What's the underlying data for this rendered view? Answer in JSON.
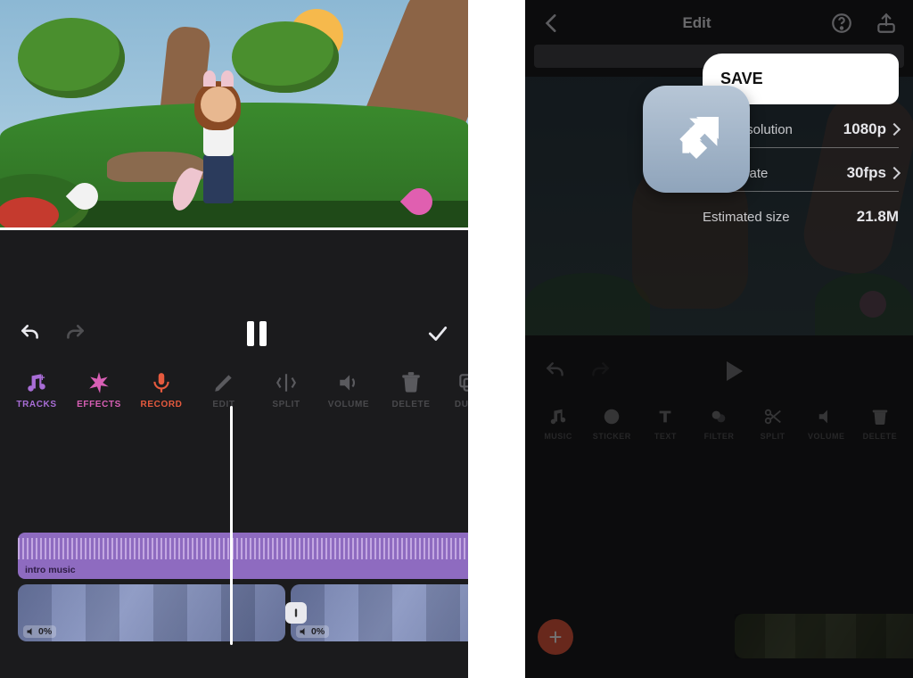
{
  "leftPhone": {
    "toolbar": [
      {
        "key": "tracks",
        "label": "TRACKS"
      },
      {
        "key": "effects",
        "label": "EFFECTS"
      },
      {
        "key": "record",
        "label": "RECORD"
      },
      {
        "key": "edit",
        "label": "EDIT"
      },
      {
        "key": "split",
        "label": "SPLIT"
      },
      {
        "key": "volume",
        "label": "VOLUME"
      },
      {
        "key": "delete",
        "label": "DELETE"
      },
      {
        "key": "dupe",
        "label": "DUPE"
      }
    ],
    "audioClip": {
      "label": "intro music"
    },
    "clipA": {
      "volume": "0%"
    },
    "clipB": {
      "volume": "0%"
    }
  },
  "rightPhone": {
    "topbarTitle": "Edit",
    "saveLabel": "SAVE",
    "settings": {
      "resolution": {
        "label": "Resolution",
        "value": "1080p"
      },
      "framerate": {
        "label": "Frame rate",
        "value": "30fps"
      },
      "estsize": {
        "label": "Estimated size",
        "value": "21.8M"
      }
    },
    "toolbar": [
      {
        "key": "music",
        "label": "MUSIC"
      },
      {
        "key": "sticker",
        "label": "STICKER"
      },
      {
        "key": "text",
        "label": "TEXT"
      },
      {
        "key": "filter",
        "label": "FILTER"
      },
      {
        "key": "split",
        "label": "SPLIT"
      },
      {
        "key": "volume",
        "label": "VOLUME"
      },
      {
        "key": "delete",
        "label": "DELETE"
      }
    ]
  }
}
